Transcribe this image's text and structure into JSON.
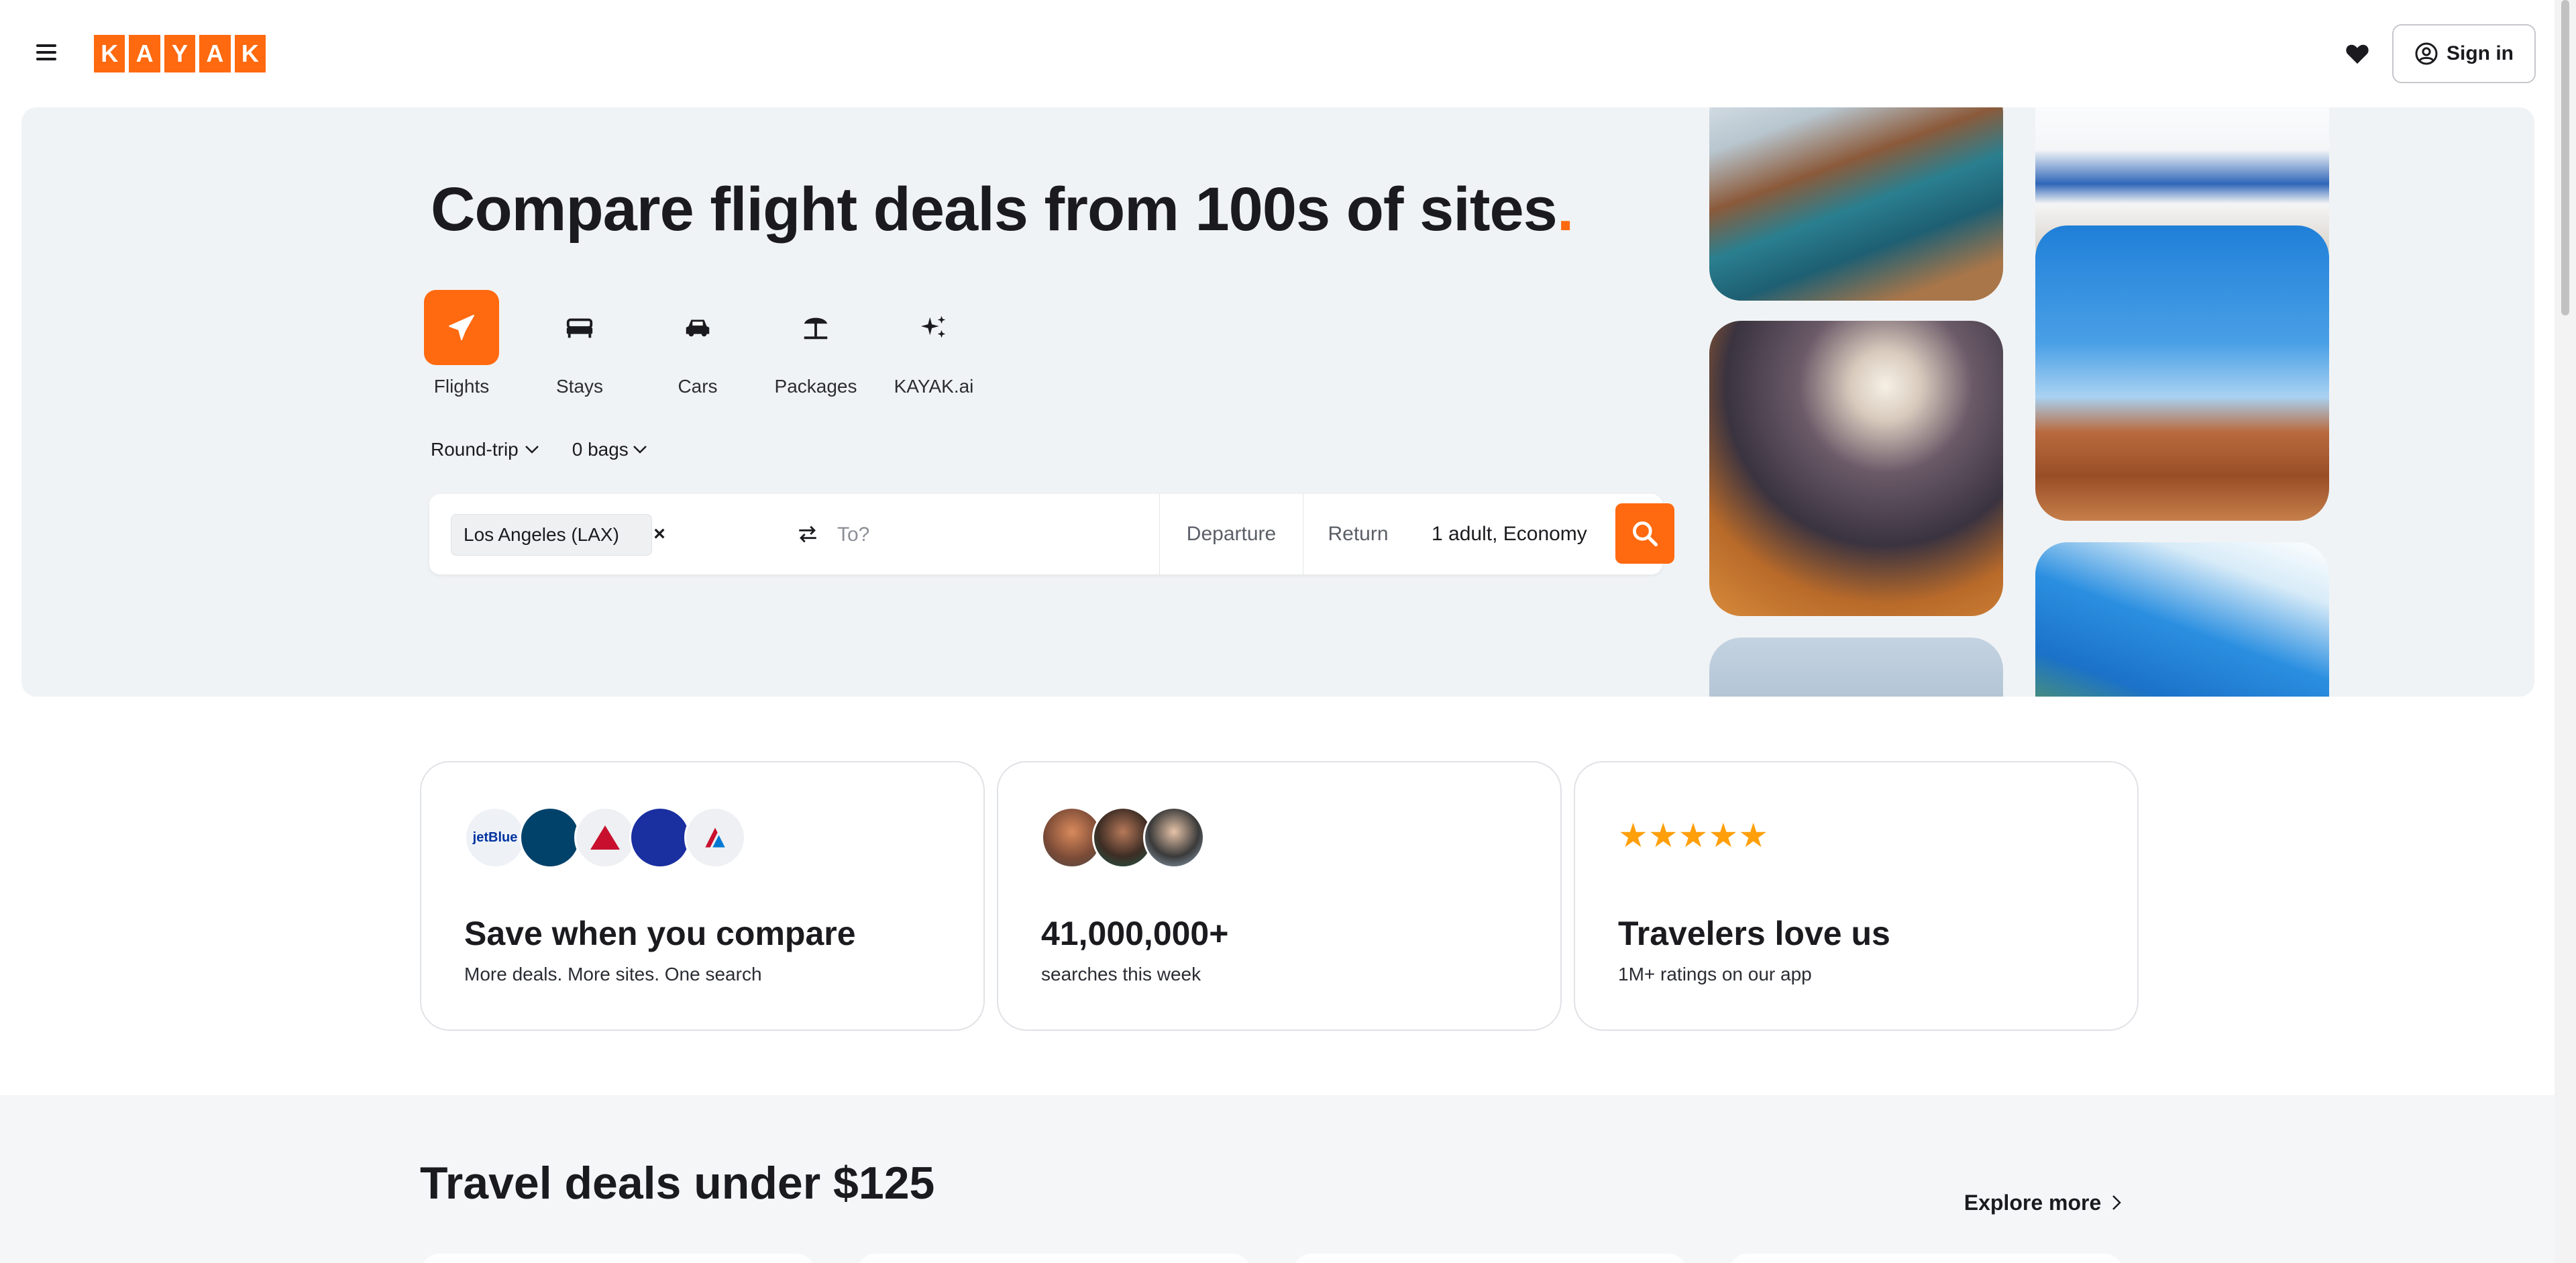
{
  "header": {
    "menu_icon": "hamburger-icon",
    "logo_letters": [
      "K",
      "A",
      "Y",
      "A",
      "K"
    ],
    "favorites_icon": "heart-icon",
    "signin_label": "Sign in",
    "signin_icon": "user-circle-icon"
  },
  "hero": {
    "title": "Compare flight deals from 100s of sites",
    "title_dot": ".",
    "verticals": [
      {
        "label": "Flights",
        "icon": "plane-icon",
        "active": true
      },
      {
        "label": "Stays",
        "icon": "bed-icon",
        "active": false
      },
      {
        "label": "Cars",
        "icon": "car-icon",
        "active": false
      },
      {
        "label": "Packages",
        "icon": "beach-umbrella-icon",
        "active": false
      },
      {
        "label": "KAYAK.ai",
        "icon": "sparkles-icon",
        "active": false
      }
    ],
    "trip_type": "Round-trip",
    "bags": "0 bags",
    "origin_chip": "Los Angeles (LAX)",
    "origin_remove": "×",
    "to_placeholder": "To?",
    "departure_label": "Departure",
    "return_label": "Return",
    "travelers": "1 adult, Economy"
  },
  "value_cards": [
    {
      "title": "Save when you compare",
      "subtitle": "More deals. More sites. One search",
      "airline_logos": [
        "jetBlue",
        "Alaska",
        "Delta",
        "United",
        "American"
      ]
    },
    {
      "title": "41,000,000+",
      "subtitle": "searches this week"
    },
    {
      "title": "Travelers love us",
      "subtitle": "1M+ ratings on our app",
      "stars": "★★★★★"
    }
  ],
  "deals": {
    "title": "Travel deals under $125",
    "explore_label": "Explore more"
  },
  "colors": {
    "brand": "#ff690f",
    "hero_bg": "#f0f3f5",
    "star": "#ff9f0a"
  }
}
